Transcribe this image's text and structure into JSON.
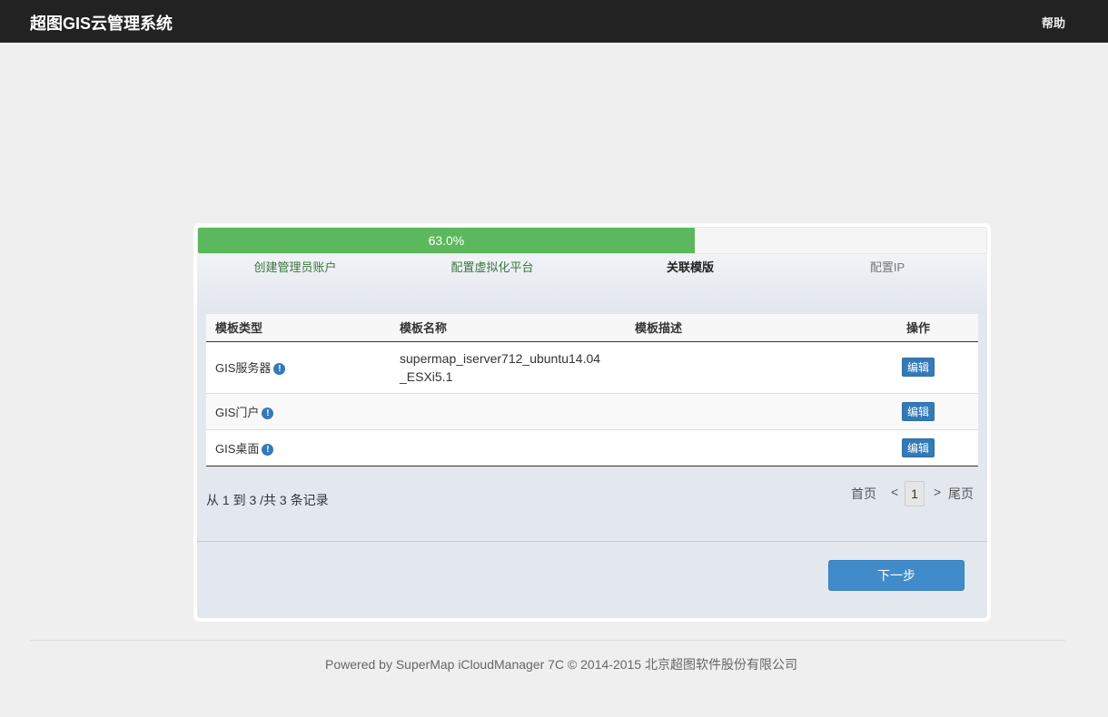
{
  "header": {
    "brand": "超图GIS云管理系统",
    "help": "帮助"
  },
  "progress": {
    "label": "63.0%",
    "value": 63.0,
    "color": "#5cb85c"
  },
  "steps": [
    {
      "label": "创建管理员账户",
      "state": "done"
    },
    {
      "label": "配置虚拟化平台",
      "state": "done"
    },
    {
      "label": "关联模版",
      "state": "active"
    },
    {
      "label": "配置IP",
      "state": "todo"
    }
  ],
  "table": {
    "columns": [
      "模板类型",
      "模板名称",
      "模板描述",
      "操作"
    ],
    "rows": [
      {
        "type": "GIS服务器",
        "name_line1": "supermap_iserver712_ubuntu14.04",
        "name_line2": "_ESXi5.1",
        "desc": "",
        "action": "编辑"
      },
      {
        "type": "GIS门户",
        "name_line1": "",
        "name_line2": "",
        "desc": "",
        "action": "编辑"
      },
      {
        "type": "GIS桌面",
        "name_line1": "",
        "name_line2": "",
        "desc": "",
        "action": "编辑"
      }
    ]
  },
  "records_text": "从 1 到 3 /共 3 条记录",
  "pager": {
    "first": "首页",
    "prev": "<",
    "current": "1",
    "next": ">",
    "last": "尾页"
  },
  "next_button": "下一步",
  "footer": "Powered by SuperMap iCloudManager 7C © 2014-2015 北京超图软件股份有限公司",
  "colors": {
    "navbar": "#222222",
    "primary": "#428bca",
    "success": "#5cb85c"
  }
}
